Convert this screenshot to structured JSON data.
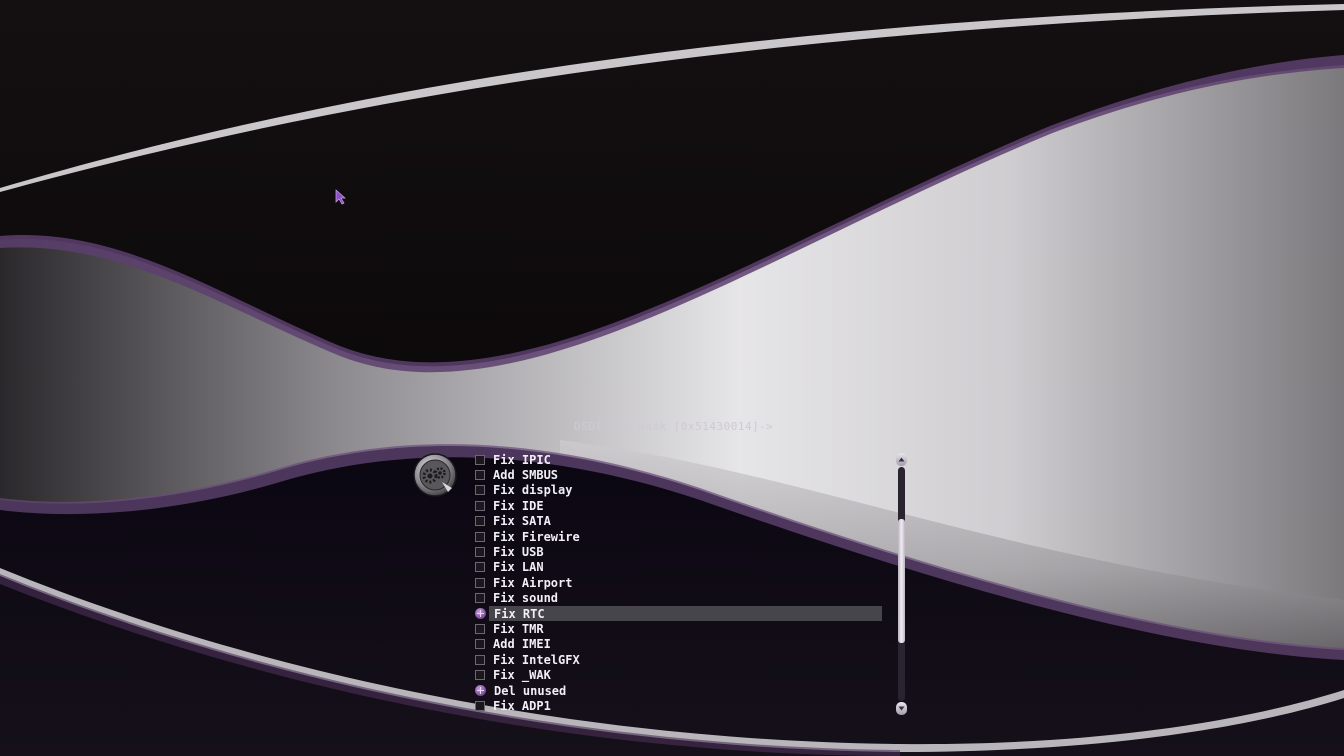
{
  "header": {
    "title": "DSDT fix mask [0x51430014]->"
  },
  "menu": {
    "items": [
      {
        "label": "Fix IPIC",
        "checked": false,
        "selected": false
      },
      {
        "label": "Add SMBUS",
        "checked": false,
        "selected": false
      },
      {
        "label": "Fix display",
        "checked": false,
        "selected": false
      },
      {
        "label": "Fix IDE",
        "checked": false,
        "selected": false
      },
      {
        "label": "Fix SATA",
        "checked": false,
        "selected": false
      },
      {
        "label": "Fix Firewire",
        "checked": false,
        "selected": false
      },
      {
        "label": "Fix USB",
        "checked": false,
        "selected": false
      },
      {
        "label": "Fix LAN",
        "checked": false,
        "selected": false
      },
      {
        "label": "Fix Airport",
        "checked": false,
        "selected": false
      },
      {
        "label": "Fix sound",
        "checked": false,
        "selected": false
      },
      {
        "label": "Fix RTC",
        "checked": true,
        "selected": true
      },
      {
        "label": "Fix TMR",
        "checked": false,
        "selected": false
      },
      {
        "label": "Add IMEI",
        "checked": false,
        "selected": false
      },
      {
        "label": "Fix IntelGFX",
        "checked": false,
        "selected": false
      },
      {
        "label": "Fix _WAK",
        "checked": false,
        "selected": false
      },
      {
        "label": "Del unused",
        "checked": true,
        "selected": false
      },
      {
        "label": "Fix ADP1",
        "checked": false,
        "selected": false
      }
    ]
  },
  "scrollbar": {
    "position_fraction": 0.2
  },
  "icons": {
    "logo": "gears-logo-icon",
    "cursor": "mouse-pointer-icon",
    "scroll_up": "chevron-up-icon",
    "scroll_down": "chevron-down-icon"
  },
  "colors": {
    "accent": "#8a5aa8",
    "background": "#0a0708",
    "text": "#f2eef5",
    "selection": "#5a585f"
  }
}
